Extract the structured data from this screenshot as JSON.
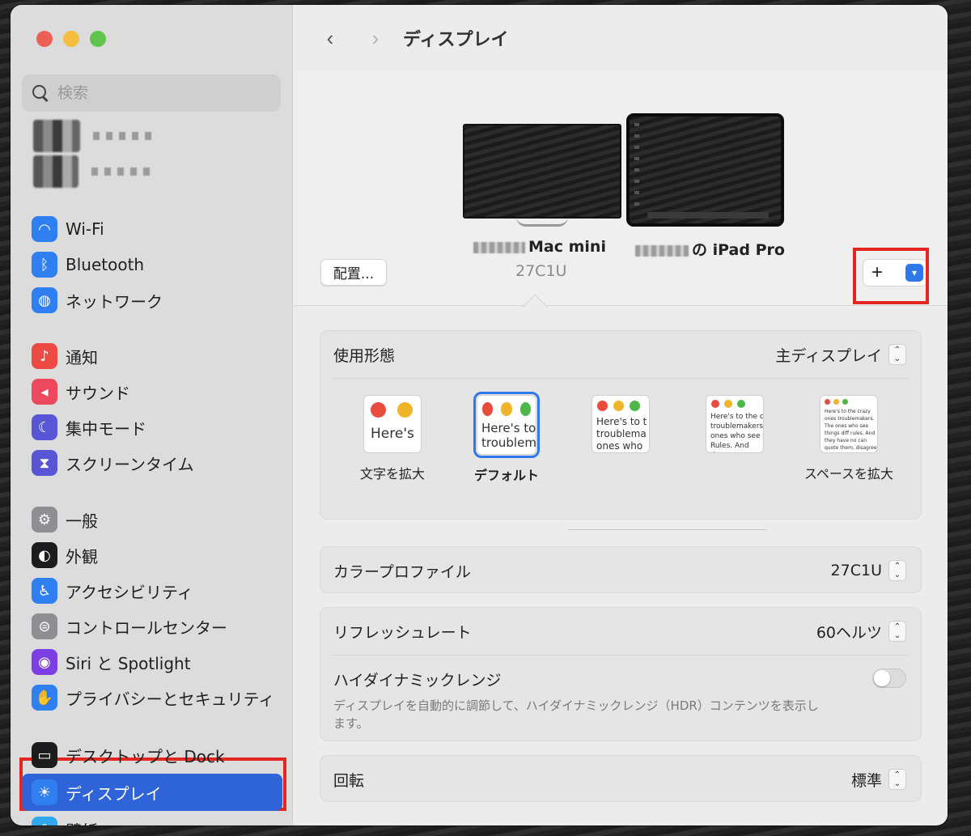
{
  "window": {
    "title": "ディスプレイ"
  },
  "sidebar": {
    "search_placeholder": "検索",
    "groups": [
      [
        {
          "label": "Wi-Fi",
          "icon": "wifi-icon",
          "color": "#2f7ff0"
        },
        {
          "label": "Bluetooth",
          "icon": "bluetooth-icon",
          "color": "#2f7ff0"
        },
        {
          "label": "ネットワーク",
          "icon": "globe-icon",
          "color": "#2f7ff0"
        }
      ],
      [
        {
          "label": "通知",
          "icon": "bell-icon",
          "color": "#ec4a42"
        },
        {
          "label": "サウンド",
          "icon": "speaker-icon",
          "color": "#ec4a5c"
        },
        {
          "label": "集中モード",
          "icon": "moon-icon",
          "color": "#5856d6"
        },
        {
          "label": "スクリーンタイム",
          "icon": "hourglass-icon",
          "color": "#5856d6"
        }
      ],
      [
        {
          "label": "一般",
          "icon": "gear-icon",
          "color": "#8e8e93"
        },
        {
          "label": "外観",
          "icon": "appearance-icon",
          "color": "#1c1c1e"
        },
        {
          "label": "アクセシビリティ",
          "icon": "accessibility-icon",
          "color": "#2f7ff0"
        },
        {
          "label": "コントロールセンター",
          "icon": "toggles-icon",
          "color": "#8e8e93"
        },
        {
          "label": "Siri と Spotlight",
          "icon": "siri-icon",
          "color": "#7b3fe4"
        },
        {
          "label": "プライバシーとセキュリティ",
          "icon": "hand-icon",
          "color": "#2f7ff0"
        }
      ],
      [
        {
          "label": "デスクトップと Dock",
          "icon": "dock-icon",
          "color": "#1c1c1e"
        },
        {
          "label": "ディスプレイ",
          "icon": "sun-icon",
          "color": "#2f7ff0",
          "selected": true
        },
        {
          "label": "壁紙",
          "icon": "wallpaper-icon",
          "color": "#2fa8f0"
        }
      ]
    ]
  },
  "displays": {
    "mac_label": "Mac mini",
    "mac_sub": "27C1U",
    "ipad_label": "の iPad Pro",
    "arrange_button": "配置...",
    "add_button": "+"
  },
  "usage": {
    "label": "使用形態",
    "value": "主ディスプレイ"
  },
  "resolution": {
    "options": [
      {
        "label": "文字を拡大",
        "sample": "Here's"
      },
      {
        "label": "デフォルト",
        "sample": "Here's to troublem"
      },
      {
        "label": "",
        "sample": "Here's to t troublema ones who"
      },
      {
        "label": "",
        "sample": "Here's to the cr troublemakers. ones who see t Rules. And they"
      },
      {
        "label": "スペースを拡大",
        "sample": "Here's to the crazy ones troublemakers. The ones who see things diff rules. And they have no can quote them, disagree them. About the only thi Because they change th"
      }
    ]
  },
  "color_profile": {
    "label": "カラープロファイル",
    "value": "27C1U"
  },
  "refresh": {
    "label": "リフレッシュレート",
    "value": "60ヘルツ"
  },
  "hdr": {
    "label": "ハイダイナミックレンジ",
    "desc": "ディスプレイを自動的に調節して、ハイダイナミックレンジ（HDR）コンテンツを表示します。"
  },
  "rotation": {
    "label": "回転",
    "value": "標準"
  }
}
